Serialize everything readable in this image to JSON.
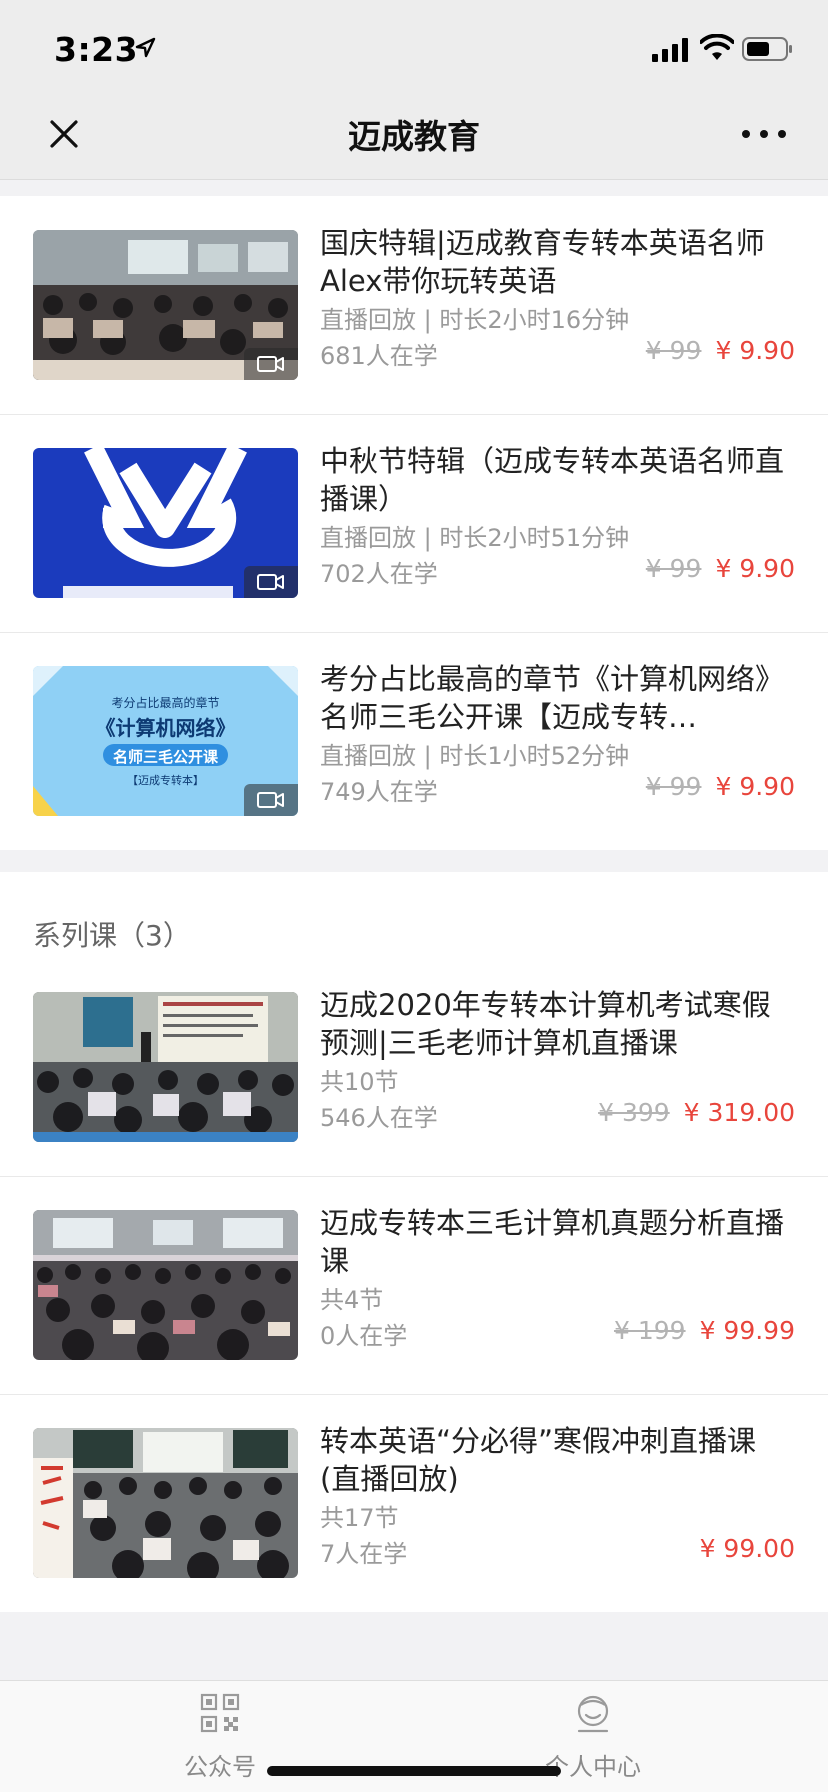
{
  "status_bar": {
    "time": "3:23"
  },
  "nav": {
    "title": "迈成教育"
  },
  "live_courses": [
    {
      "title": "国庆特辑|迈成教育专转本英语名师Alex带你玩转英语",
      "meta": "直播回放 | 时长2小时16分钟",
      "learners": "681人在学",
      "old_price": "¥ 99",
      "price": "¥ 9.90",
      "thumb": "classroom-photo"
    },
    {
      "title": "中秋节特辑（迈成专转本英语名师直播课）",
      "meta": "直播回放 | 时长2小时51分钟",
      "learners": "702人在学",
      "old_price": "¥ 99",
      "price": "¥ 9.90",
      "thumb": "logo-blue"
    },
    {
      "title": "考分占比最高的章节《计算机网络》名师三毛公开课【迈成专转…",
      "meta": "直播回放 | 时长1小时52分钟",
      "learners": "749人在学",
      "old_price": "¥ 99",
      "price": "¥ 9.90",
      "thumb": "network-poster"
    }
  ],
  "poster": {
    "line1": "考分占比最高的章节",
    "line2": "《计算机网络》",
    "line3": "名师三毛公开课",
    "line4": "【迈成专转本】"
  },
  "series": {
    "heading": "系列课（3）",
    "courses": [
      {
        "title": "迈成2020年专转本计算机考试寒假预测|三毛老师计算机直播课",
        "meta": "共10节",
        "learners": "546人在学",
        "old_price": "¥ 399",
        "price": "¥ 319.00",
        "thumb": "lecture-photo"
      },
      {
        "title": "迈成专转本三毛计算机真题分析直播课",
        "meta": "共4节",
        "learners": "0人在学",
        "old_price": "¥ 199",
        "price": "¥ 99.99",
        "thumb": "hall-photo"
      },
      {
        "title": "转本英语“分必得”寒假冲刺直播课(直播回放)",
        "meta": "共17节",
        "learners": "7人在学",
        "old_price": "",
        "price": "¥ 99.00",
        "thumb": "class-photo"
      }
    ]
  },
  "tabbar": [
    {
      "label": "公众号",
      "icon": "qrcode-icon"
    },
    {
      "label": "个人中心",
      "icon": "user-icon"
    }
  ],
  "colors": {
    "price": "#e8453c",
    "logo_blue": "#1b3bbd",
    "poster_blue": "#8fd0f5"
  }
}
